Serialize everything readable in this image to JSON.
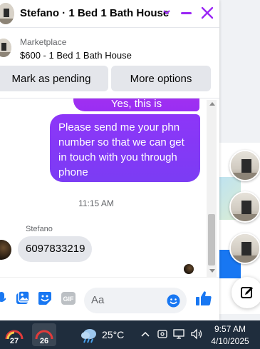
{
  "chat": {
    "title": "Stefano · 1 Bed 1 Bath House",
    "marketplace_label": "Marketplace",
    "listing": "$600 - 1 Bed 1 Bath House",
    "pending_button": "Mark as pending",
    "more_button": "More options"
  },
  "messages": {
    "outgoing_1": "Yes, this is  astillvailable",
    "outgoing_2": "Please send me your phn number so that we can get in touch with you through phone",
    "timestamp": "11:15 AM",
    "sender_name": "Stefano",
    "incoming_1": "6097833219"
  },
  "composer": {
    "placeholder": "Aa"
  },
  "taskbar": {
    "app1_badge": "27",
    "app2_badge": "26",
    "temperature": "25°C",
    "time": "9:57 AM",
    "date": "4/10/2025"
  },
  "colors": {
    "accent": "#9a26f5",
    "bubble_out_top": "#a431f0",
    "bubble_out_bottom": "#7b3cf4",
    "like_blue": "#1877f2",
    "taskbar": "#1f2d3d"
  }
}
